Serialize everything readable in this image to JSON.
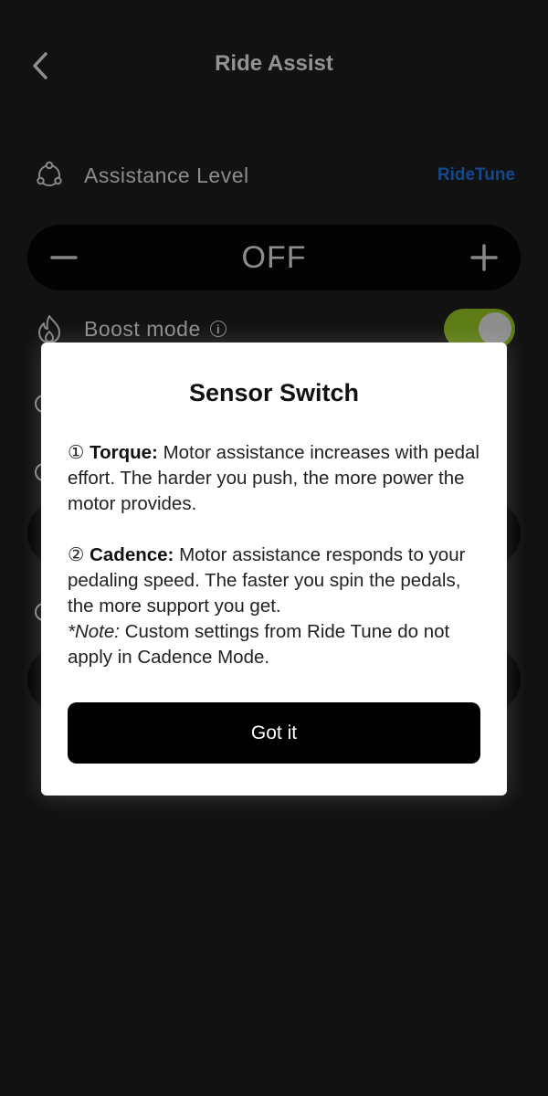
{
  "header": {
    "title": "Ride Assist",
    "back_icon": "chevron-left-icon"
  },
  "assistance": {
    "label": "Assistance Level",
    "link": "RideTune",
    "icon": "assist-nodes-icon",
    "level_value": "OFF",
    "minus_icon": "minus-icon",
    "plus_icon": "plus-icon"
  },
  "boost": {
    "label": "Boost mode",
    "info_glyph": "i",
    "icon": "flame-icon",
    "toggle_on": true
  },
  "colors": {
    "accent_green": "#8fbf22",
    "link_blue": "#1f6fd6",
    "background": "#1c1c1c"
  },
  "modal": {
    "title": "Sensor Switch",
    "torque_num": "①",
    "torque_label": "Torque:",
    "torque_text": "Motor assistance increases with pedal effort. The harder you push, the more power the motor provides.",
    "cadence_num": "②",
    "cadence_label": "Cadence:",
    "cadence_text": "Motor assistance responds to your pedaling speed. The faster you spin the pedals, the more support you get.",
    "note_label": "*Note:",
    "note_text": "Custom settings from Ride Tune do not apply in Cadence Mode.",
    "button_label": "Got it"
  }
}
